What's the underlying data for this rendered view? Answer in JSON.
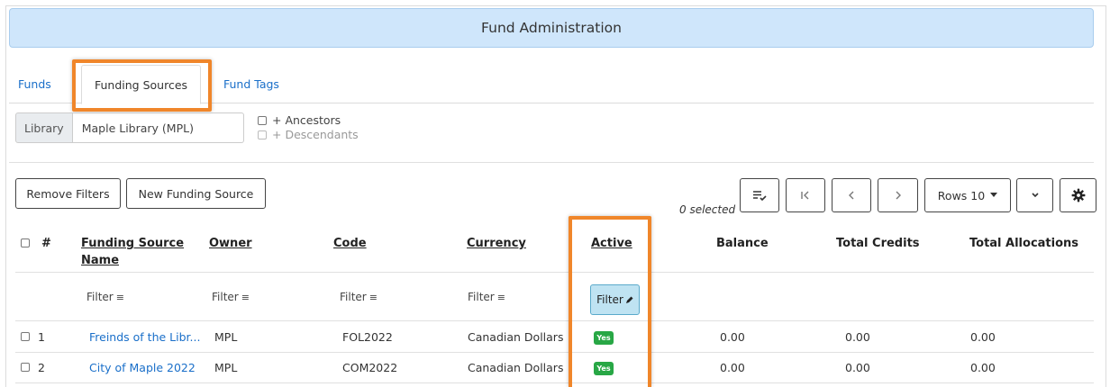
{
  "header": {
    "title": "Fund Administration"
  },
  "tabs": [
    {
      "label": "Funds"
    },
    {
      "label": "Funding Sources"
    },
    {
      "label": "Fund Tags"
    }
  ],
  "library": {
    "label": "Library",
    "value": "Maple Library (MPL)"
  },
  "checks": {
    "ancestors": "+ Ancestors",
    "descendants": "+ Descendants"
  },
  "toolbar": {
    "remove_filters": "Remove Filters",
    "new_funding_source": "New Funding Source",
    "selected": "0 selected",
    "rows": "Rows 10"
  },
  "table": {
    "headers": {
      "num": "#",
      "name_line1": "Funding Source",
      "name_line2": "Name",
      "owner": "Owner",
      "code": "Code",
      "currency": "Currency",
      "active": "Active",
      "balance": "Balance",
      "total_credits": "Total Credits",
      "total_allocations": "Total Allocations"
    },
    "filter_label": "Filter",
    "rows": [
      {
        "num": "1",
        "name": "Freinds of the Libr...",
        "owner": "MPL",
        "code": "FOL2022",
        "currency": "Canadian Dollars",
        "active": "Yes",
        "balance": "0.00",
        "credits": "0.00",
        "allocations": "0.00"
      },
      {
        "num": "2",
        "name": "City of Maple 2022",
        "owner": "MPL",
        "code": "COM2022",
        "currency": "Canadian Dollars",
        "active": "Yes",
        "balance": "0.00",
        "credits": "0.00",
        "allocations": "0.00"
      }
    ]
  },
  "colors": {
    "accent": "#1a6fc9",
    "header_bg": "#cfe6fb",
    "highlight": "#f0862a",
    "badge": "#28a745"
  }
}
